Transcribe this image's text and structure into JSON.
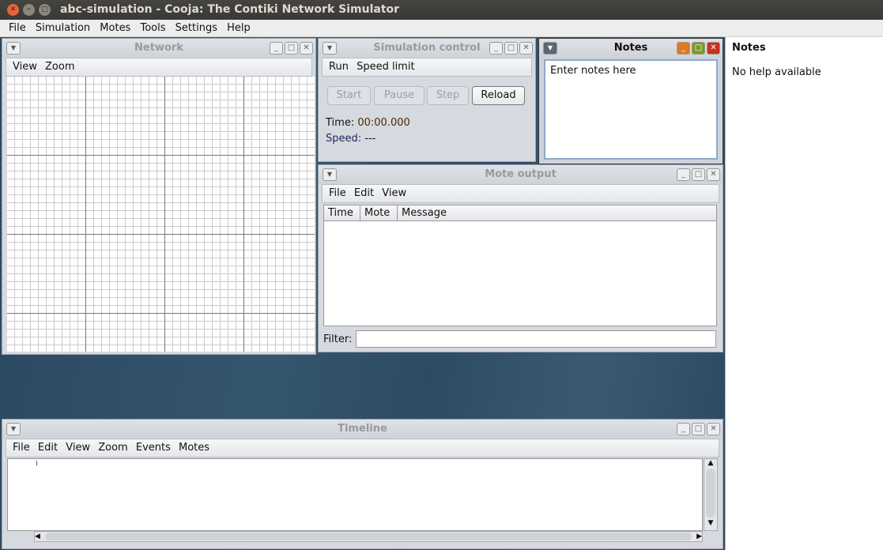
{
  "window": {
    "title": "abc-simulation - Cooja: The Contiki Network Simulator"
  },
  "menubar": [
    "File",
    "Simulation",
    "Motes",
    "Tools",
    "Settings",
    "Help"
  ],
  "network": {
    "title": "Network",
    "menu": [
      "View",
      "Zoom"
    ]
  },
  "simcontrol": {
    "title": "Simulation control",
    "menu": [
      "Run",
      "Speed limit"
    ],
    "buttons": {
      "start": "Start",
      "pause": "Pause",
      "step": "Step",
      "reload": "Reload"
    },
    "time_label": "Time:",
    "time": "00:00.000",
    "speed_label": "Speed:",
    "speed": "---"
  },
  "notes": {
    "title": "Notes",
    "text": "Enter notes here"
  },
  "moteoutput": {
    "title": "Mote output",
    "menu": [
      "File",
      "Edit",
      "View"
    ],
    "columns": [
      "Time",
      "Mote",
      "Message"
    ],
    "filter_label": "Filter:",
    "filter_value": ""
  },
  "timeline": {
    "title": "Timeline",
    "menu": [
      "File",
      "Edit",
      "View",
      "Zoom",
      "Events",
      "Motes"
    ]
  },
  "help": {
    "title": "Notes",
    "text": "No help available"
  }
}
